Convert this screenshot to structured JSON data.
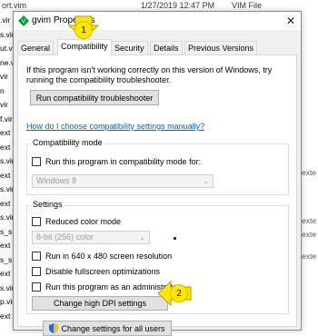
{
  "background": {
    "file_name": "ort.vim",
    "date": "1/27/2019 12:47 PM",
    "file_type": "VIM File",
    "left_fragments": [
      ".vir",
      "s.vir",
      "ut.vi",
      "ne.vi",
      "vir",
      "n",
      "vir",
      "f.vir",
      "ext",
      "ext",
      "s.vir",
      "ext",
      "s.vir",
      "ext",
      "s.vir",
      "s_s",
      "ext",
      "s_s",
      "ext",
      "s.vir",
      "p.vir",
      "ext"
    ],
    "right_fragments": [
      "exte",
      "exte",
      "exte",
      "exte"
    ]
  },
  "dialog": {
    "title": "gvim Properties",
    "close_glyph": "✕",
    "tabs": [
      "General",
      "Compatibility",
      "Security",
      "Details",
      "Previous Versions"
    ],
    "intro_text": "If this program isn't working correctly on this version of Windows, try running the compatibility troubleshooter.",
    "troubleshooter_button": "Run compatibility troubleshooter",
    "help_link": "How do I choose compatibility settings manually?",
    "compat_mode": {
      "group_label": "Compatibility mode",
      "checkbox_label": "Run this program in compatibility mode for:",
      "dropdown_value": "Windows 8"
    },
    "settings": {
      "group_label": "Settings",
      "reduced_color": "Reduced color mode",
      "color_dropdown": "8-bit (256) color",
      "resolution": "Run in 640 x 480 screen resolution",
      "fullscreen": "Disable fullscreen optimizations",
      "admin": "Run this program as an administrator",
      "dpi_button": "Change high DPI settings"
    },
    "all_users_button": "Change settings for all users"
  },
  "annotations": {
    "badge1": "1",
    "badge2": "2",
    "badge_color": "#ffe800",
    "arrow_color": "#ffe800"
  },
  "icons": {
    "title": "vim-icon",
    "shield": "shield-icon"
  }
}
